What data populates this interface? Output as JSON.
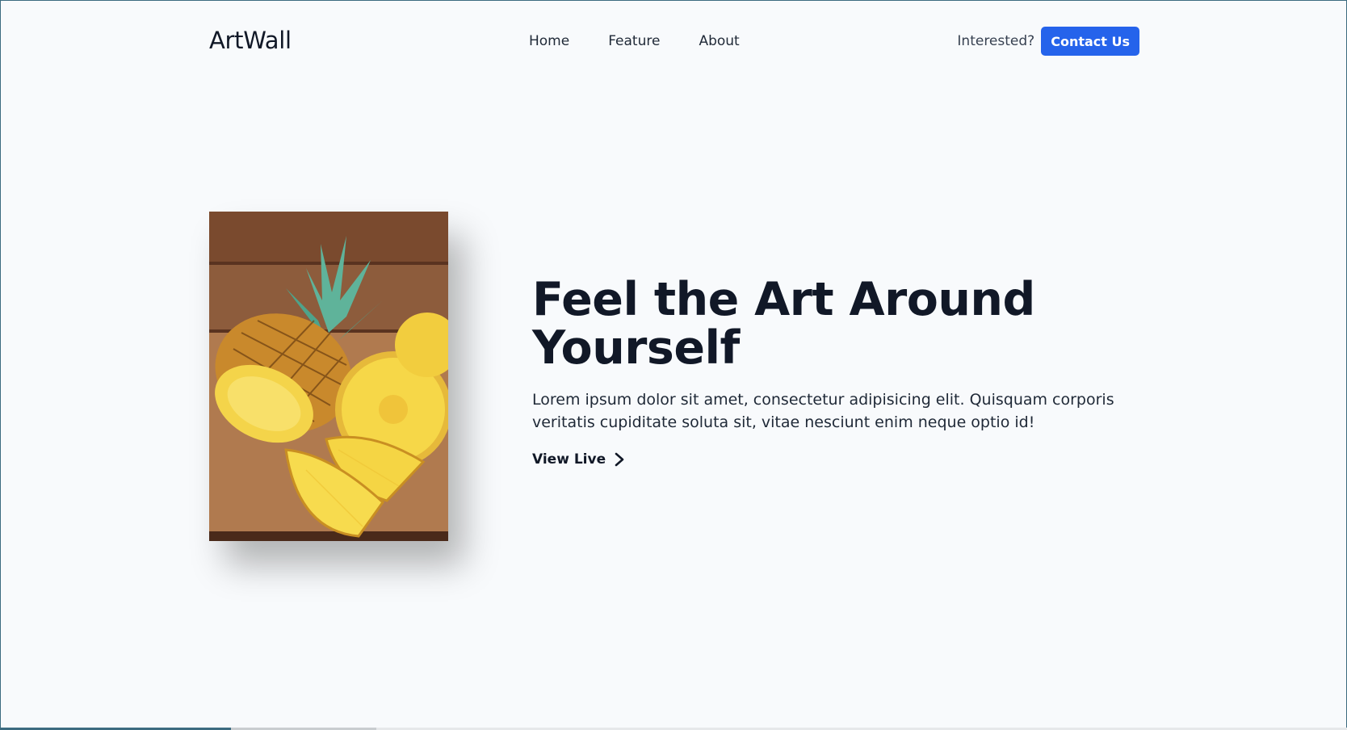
{
  "nav": {
    "logo": "ArtWall",
    "links": [
      "Home",
      "Feature",
      "About"
    ],
    "interested_text": "Interested?",
    "contact_label": "Contact Us"
  },
  "hero": {
    "headline_line1": "Feel the Art Around",
    "headline_line2": "Yourself",
    "description": "Lorem ipsum dolor sit amet, consectetur adipisicing elit. Quisquam corporis veritatis cupiditate soluta sit, vitae nesciunt enim neque optio id!",
    "cta_label": "View Live",
    "image_icon": "pineapple-photo"
  },
  "colors": {
    "background": "#f8fafc",
    "accent": "#2563eb",
    "text": "#111827"
  }
}
